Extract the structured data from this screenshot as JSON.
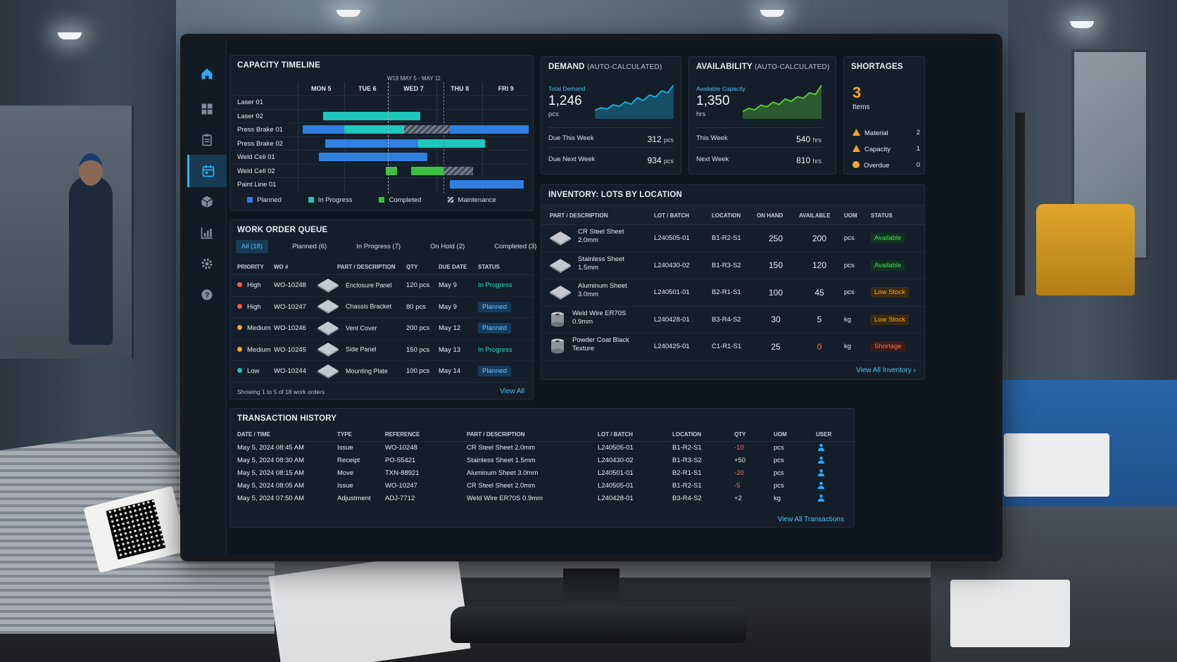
{
  "capacity": {
    "title": "CAPACITY TIMELINE",
    "week_label": "W19 MAY 5 - MAY 11",
    "days": [
      "MON 5",
      "TUE 6",
      "WED 7",
      "THU 8",
      "FRI 9"
    ],
    "resources": [
      "Laser 01",
      "Laser 02",
      "Press Brake 01",
      "Press Brake 02",
      "Weld Cell 01",
      "Weld Cell 02",
      "Paint Line 01"
    ],
    "legend": [
      {
        "label": "Planned",
        "color": "#2f7fe0"
      },
      {
        "label": "In Progress",
        "color": "#1fc7bc"
      },
      {
        "label": "Completed",
        "color": "#3fbf3f"
      },
      {
        "label": "Maintenance",
        "color": "#8a96a2"
      }
    ],
    "bars": [
      {
        "row": 1,
        "start": 0.55,
        "end": 2.65,
        "status": "In Progress"
      },
      {
        "row": 2,
        "start": 0.1,
        "end": 1.0,
        "status": "Planned"
      },
      {
        "row": 2,
        "start": 1.0,
        "end": 2.3,
        "status": "In Progress"
      },
      {
        "row": 2,
        "start": 2.3,
        "end": 3.3,
        "status": "Maintenance"
      },
      {
        "row": 2,
        "start": 3.3,
        "end": 5.0,
        "status": "Planned"
      },
      {
        "row": 3,
        "start": 0.6,
        "end": 2.6,
        "status": "Planned"
      },
      {
        "row": 3,
        "start": 2.6,
        "end": 4.05,
        "status": "In Progress"
      },
      {
        "row": 4,
        "start": 0.45,
        "end": 2.8,
        "status": "Planned"
      },
      {
        "row": 5,
        "start": 1.9,
        "end": 2.15,
        "status": "Completed"
      },
      {
        "row": 5,
        "start": 2.45,
        "end": 3.15,
        "status": "Completed"
      },
      {
        "row": 5,
        "start": 3.15,
        "end": 3.8,
        "status": "Maintenance"
      },
      {
        "row": 6,
        "start": 3.3,
        "end": 4.9,
        "status": "Planned"
      }
    ],
    "today_position": 1.95,
    "maintenance_position": 3.15
  },
  "demand": {
    "title": "DEMAND",
    "subtitle": "(AUTO-CALCULATED)",
    "label": "Total Demand",
    "value": "1,246",
    "unit": "pcs",
    "spark": [
      8,
      12,
      10,
      16,
      14,
      20,
      17,
      26,
      22,
      30,
      27,
      36,
      33,
      44
    ],
    "rows": [
      {
        "label": "Due This Week",
        "value": "312",
        "unit": "pcs"
      },
      {
        "label": "Due Next Week",
        "value": "934",
        "unit": "pcs"
      }
    ],
    "color": "#1aa9d6"
  },
  "availability": {
    "title": "AVAILABILITY",
    "subtitle": "(AUTO-CALCULATED)",
    "label": "Available Capacity",
    "value": "1,350",
    "unit": "hrs",
    "spark": [
      6,
      10,
      8,
      14,
      12,
      18,
      15,
      22,
      19,
      25,
      23,
      30,
      28,
      40
    ],
    "rows": [
      {
        "label": "This Week",
        "value": "540",
        "unit": "hrs"
      },
      {
        "label": "Next Week",
        "value": "810",
        "unit": "hrs"
      }
    ],
    "color": "#5cc83a"
  },
  "shortages": {
    "title": "SHORTAGES",
    "count": "3",
    "count_label": "Items",
    "rows": [
      {
        "label": "Material",
        "value": "2",
        "icon": "warning-icon",
        "color": "#f5a623"
      },
      {
        "label": "Capacity",
        "value": "1",
        "icon": "warning-icon",
        "color": "#f5a623"
      },
      {
        "label": "Overdue",
        "value": "0",
        "icon": "alert-circle-icon",
        "color": "#f5a623"
      }
    ]
  },
  "work_orders": {
    "title": "WORK ORDER QUEUE",
    "tabs": [
      "All (18)",
      "Planned (6)",
      "In Progress (7)",
      "On Hold (2)",
      "Completed (3)"
    ],
    "columns": [
      "PRIORITY",
      "WO #",
      "PART / DESCRIPTION",
      "QTY",
      "DUE DATE",
      "STATUS"
    ],
    "rows": [
      {
        "priority": "High",
        "priority_color": "#ff5a4e",
        "wo": "WO-10248",
        "part": "Enclosure Panel",
        "qty": "120 pcs",
        "due": "May 9",
        "status": "In Progress"
      },
      {
        "priority": "High",
        "priority_color": "#ff5a4e",
        "wo": "WO-10247",
        "part": "Chassis Bracket",
        "qty": "80 pcs",
        "due": "May 9",
        "status": "Planned"
      },
      {
        "priority": "Medium",
        "priority_color": "#f5a623",
        "wo": "WO-10246",
        "part": "Vent Cover",
        "qty": "200 pcs",
        "due": "May 12",
        "status": "Planned"
      },
      {
        "priority": "Medium",
        "priority_color": "#f5a623",
        "wo": "WO-10245",
        "part": "Side Panel",
        "qty": "150 pcs",
        "due": "May 13",
        "status": "In Progress"
      },
      {
        "priority": "Low",
        "priority_color": "#1fc7bc",
        "wo": "WO-10244",
        "part": "Mounting Plate",
        "qty": "100 pcs",
        "due": "May 14",
        "status": "Planned"
      }
    ],
    "footer": "Showing 1 to 5 of 18 work orders",
    "view_all": "View All"
  },
  "inventory": {
    "title": "INVENTORY: LOTS BY LOCATION",
    "columns": [
      "PART / DESCRIPTION",
      "LOT / BATCH",
      "LOCATION",
      "ON HAND",
      "AVAILABLE",
      "UOM",
      "STATUS"
    ],
    "rows": [
      {
        "part": "CR Steel Sheet",
        "spec": "2.0mm",
        "lot": "L240505-01",
        "loc": "B1-R2-S1",
        "on_hand": "250",
        "available": "200",
        "uom": "pcs",
        "status": "Available",
        "kind": "sheet"
      },
      {
        "part": "Stainless Sheet",
        "spec": "1.5mm",
        "lot": "L240430-02",
        "loc": "B1-R3-S2",
        "on_hand": "150",
        "available": "120",
        "uom": "pcs",
        "status": "Available",
        "kind": "sheet"
      },
      {
        "part": "Aluminum Sheet",
        "spec": "3.0mm",
        "lot": "L240501-01",
        "loc": "B2-R1-S1",
        "on_hand": "100",
        "available": "45",
        "uom": "pcs",
        "status": "Low Stock",
        "kind": "sheet"
      },
      {
        "part": "Weld Wire ER70S",
        "spec": "0.9mm",
        "lot": "L240428-01",
        "loc": "B3-R4-S2",
        "on_hand": "30",
        "available": "5",
        "uom": "kg",
        "status": "Low Stock",
        "kind": "spool"
      },
      {
        "part": "Powder Coat Black",
        "spec": "Texture",
        "lot": "L240425-01",
        "loc": "C1-R1-S1",
        "on_hand": "25",
        "available": "0",
        "uom": "kg",
        "status": "Shortage",
        "kind": "spool"
      }
    ],
    "view_all": "View All Inventory"
  },
  "transactions": {
    "title": "TRANSACTION HISTORY",
    "columns": [
      "DATE / TIME",
      "TYPE",
      "REFERENCE",
      "PART / DESCRIPTION",
      "LOT / BATCH",
      "LOCATION",
      "QTY",
      "UOM",
      "USER"
    ],
    "rows": [
      {
        "date": "May 5, 2024 08:45 AM",
        "type": "Issue",
        "ref": "WO-10248",
        "part": "CR Steel Sheet 2.0mm",
        "lot": "L240505-01",
        "loc": "B1-R2-S1",
        "qty": "-10",
        "uom": "pcs"
      },
      {
        "date": "May 5, 2024 08:30 AM",
        "type": "Receipt",
        "ref": "PO-55421",
        "part": "Stainless Sheet 1.5mm",
        "lot": "L240430-02",
        "loc": "B1-R3-S2",
        "qty": "+50",
        "uom": "pcs"
      },
      {
        "date": "May 5, 2024 08:15 AM",
        "type": "Move",
        "ref": "TXN-88921",
        "part": "Aluminum Sheet 3.0mm",
        "lot": "L240501-01",
        "loc": "B2-R1-S1",
        "qty": "-20",
        "uom": "pcs"
      },
      {
        "date": "May 5, 2024 08:05 AM",
        "type": "Issue",
        "ref": "WO-10247",
        "part": "CR Steel Sheet 2.0mm",
        "lot": "L240505-01",
        "loc": "B1-R2-S1",
        "qty": "-5",
        "uom": "pcs"
      },
      {
        "date": "May 5, 2024 07:50 AM",
        "type": "Adjustment",
        "ref": "ADJ-7712",
        "part": "Weld Wire ER70S 0.9mm",
        "lot": "L240428-01",
        "loc": "B3-R4-S2",
        "qty": "+2",
        "uom": "kg"
      }
    ],
    "view_all": "View All Transactions"
  },
  "nav": [
    {
      "name": "home-icon"
    },
    {
      "name": "dashboard-icon"
    },
    {
      "name": "clipboard-icon"
    },
    {
      "name": "calendar-icon",
      "active": true
    },
    {
      "name": "box-icon"
    },
    {
      "name": "chart-icon"
    },
    {
      "name": "gear-icon"
    },
    {
      "name": "help-icon"
    }
  ]
}
